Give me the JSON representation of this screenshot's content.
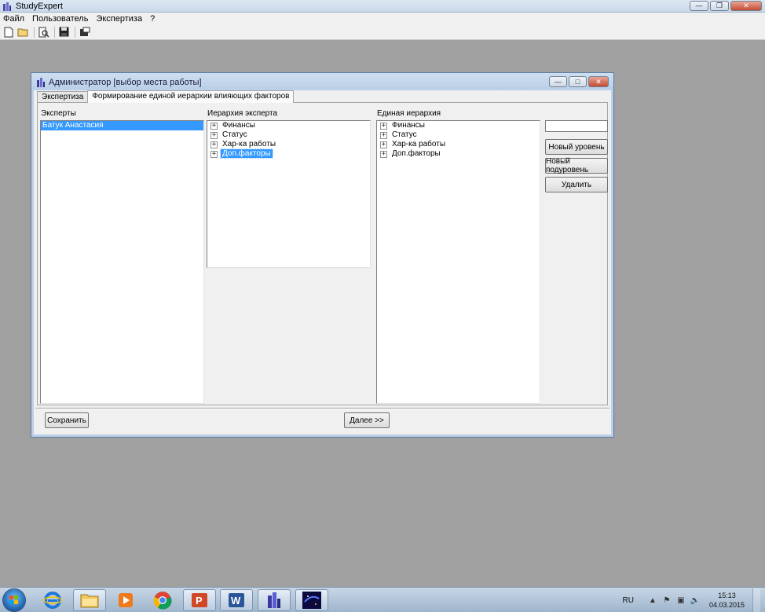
{
  "app": {
    "title": "StudyExpert",
    "menu": [
      "Файл",
      "Пользователь",
      "Экспертиза",
      "?"
    ],
    "toolbar_icons": [
      "new-document-icon",
      "open-folder-icon",
      "print-preview-icon",
      "save-icon",
      "settings-icon"
    ]
  },
  "dialog": {
    "title": "Администратор [выбор места работы]",
    "tabs": [
      "Экспертиза",
      "Формирование единой иерархии влияющих факторов"
    ],
    "active_tab": 1,
    "experts": {
      "label": "Эксперты",
      "items": [
        "Батук Анастасия"
      ],
      "selected": 0
    },
    "expert_hierarchy": {
      "label": "Иерархия эксперта",
      "nodes": [
        "Финансы",
        "Статус",
        "Хар-ка работы",
        "Доп.факторы"
      ],
      "selected": 3
    },
    "unified_hierarchy": {
      "label": "Единая иерархия",
      "nodes": [
        "Финансы",
        "Статус",
        "Хар-ка работы",
        "Доп.факторы"
      ]
    },
    "level_name_input": {
      "value": ""
    },
    "buttons": {
      "new_level": "Новый уровень",
      "new_sublevel": "Новый подуровень",
      "delete": "Удалить",
      "save": "Сохранить",
      "next": "Далее >>"
    },
    "expander_glyph": "+"
  },
  "taskbar": {
    "apps": [
      "internet-explorer-icon",
      "file-explorer-icon",
      "media-player-icon",
      "chrome-icon",
      "powerpoint-icon",
      "word-icon",
      "studyexpert-icon",
      "stellarium-icon"
    ],
    "language": "RU",
    "time": "15:13",
    "date": "04.03.2015"
  }
}
